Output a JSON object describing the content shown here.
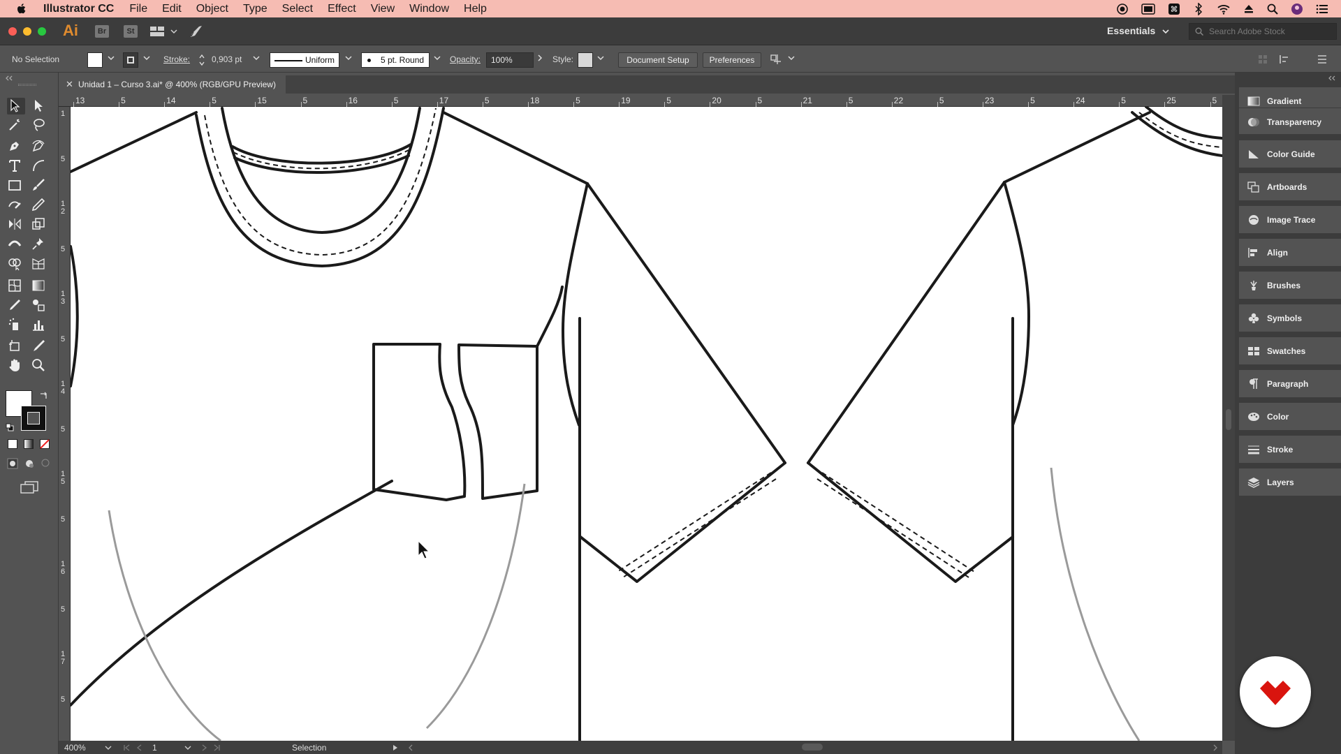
{
  "menubar": {
    "app_name": "Illustrator CC",
    "items": [
      "File",
      "Edit",
      "Object",
      "Type",
      "Select",
      "Effect",
      "View",
      "Window",
      "Help"
    ]
  },
  "appbar": {
    "logo": "Ai",
    "bridge": "Br",
    "stock": "St",
    "workspace": "Essentials",
    "stock_search_placeholder": "Search Adobe Stock"
  },
  "control": {
    "selection_state": "No Selection",
    "stroke_label": "Stroke:",
    "stroke_weight": "0,903 pt",
    "stroke_profile": "Uniform",
    "brush": "5 pt. Round",
    "opacity_label": "Opacity:",
    "opacity_value": "100%",
    "style_label": "Style:",
    "document_setup": "Document Setup",
    "preferences": "Preferences"
  },
  "document": {
    "tab_title": "Unidad 1  – Curso 3.ai* @ 400% (RGB/GPU Preview)"
  },
  "ruler": {
    "horizontal": [
      "13",
      "5",
      "14",
      "5",
      "15",
      "5",
      "16",
      "5",
      "17",
      "5",
      "18",
      "5",
      "19",
      "5",
      "20",
      "5",
      "21",
      "5",
      "22",
      "5",
      "23",
      "5",
      "24",
      "5",
      "25",
      "5"
    ],
    "vertical": [
      "1",
      "5",
      "1\n2",
      "5",
      "1\n3",
      "5",
      "1\n4",
      "5",
      "1\n5",
      "5",
      "1\n6",
      "5",
      "1\n7",
      "5"
    ]
  },
  "status": {
    "zoom": "400%",
    "artboard": "1",
    "tool": "Selection"
  },
  "panels": [
    "Gradient",
    "Transparency",
    "Color Guide",
    "Artboards",
    "Image Trace",
    "Align",
    "Brushes",
    "Symbols",
    "Swatches",
    "Paragraph",
    "Color",
    "Stroke",
    "Layers"
  ],
  "colors": {
    "menubar": "#f6bcb3",
    "badge_red": "#d9140e",
    "ai_orange": "#e08b2e"
  }
}
